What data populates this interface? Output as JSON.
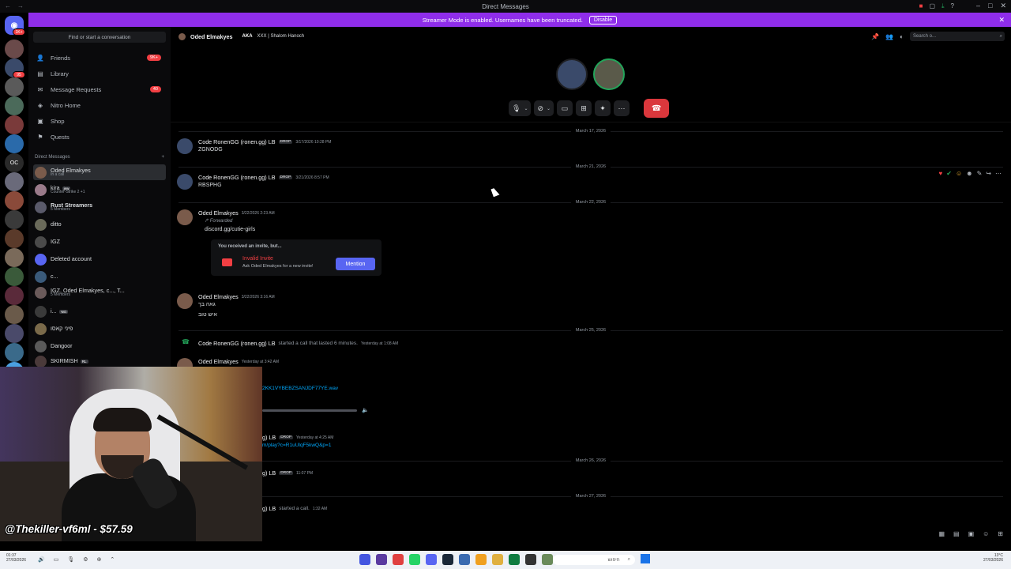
{
  "window": {
    "title": "Direct Messages"
  },
  "banner": {
    "text": "Streamer Mode is enabled. Usernames have been truncated.",
    "button": "Disable"
  },
  "sidebar": {
    "search": "Find or start a conversation",
    "nav": [
      {
        "label": "Friends",
        "icon": "friends-icon",
        "badge": "9K+"
      },
      {
        "label": "Library",
        "icon": "library-icon",
        "badge": ""
      },
      {
        "label": "Message Requests",
        "icon": "message-requests-icon",
        "badge": "40"
      },
      {
        "label": "Nitro Home",
        "icon": "nitro-icon",
        "badge": ""
      },
      {
        "label": "Shop",
        "icon": "shop-icon",
        "badge": ""
      },
      {
        "label": "Quests",
        "icon": "quests-icon",
        "badge": ""
      }
    ],
    "dm_header": "Direct Messages",
    "dm_add": "+",
    "dms": [
      {
        "name": "Oded Elmakyes",
        "sub": "In a call",
        "tag": ""
      },
      {
        "name": "kira",
        "sub": "Counter-Strike 2 +1",
        "tag": "jew"
      },
      {
        "name": "Rust Streamers",
        "sub": "5 Members",
        "tag": ""
      },
      {
        "name": "ditto",
        "sub": "",
        "tag": ""
      },
      {
        "name": "IGZ",
        "sub": "",
        "tag": ""
      },
      {
        "name": "Deleted account",
        "sub": "",
        "tag": ""
      },
      {
        "name": "c...",
        "sub": "",
        "tag": ""
      },
      {
        "name": "IGZ, Oded Elmakyes, c..., T...",
        "sub": "5 Members",
        "tag": ""
      },
      {
        "name": "i...",
        "sub": "",
        "tag": "משי"
      },
      {
        "name": "פיני קאסו",
        "sub": "",
        "tag": ""
      },
      {
        "name": "Dangoor",
        "sub": "",
        "tag": ""
      },
      {
        "name": "SKIRMISH",
        "sub": "",
        "tag": "RL"
      }
    ],
    "rail_badges": [
      "1K+",
      "95"
    ]
  },
  "header": {
    "name": "Oded Elmakyes",
    "aka_label": "AKA",
    "aka_value": "XXX | Shalom Hanoch",
    "search_placeholder": "Search o..."
  },
  "chat": {
    "dividers": [
      "March 17, 2026",
      "March 21, 2026",
      "March 22, 2026",
      "March 25, 2026",
      "March 26, 2026",
      "March 27, 2026"
    ],
    "messages": [
      {
        "user": "Code RonenGG (ronen.gg) LB",
        "tag": "DROP",
        "time": "3/17/2026 10:28 PM",
        "text": "ZGNODG"
      },
      {
        "user": "Code RonenGG (ronen.gg) LB",
        "tag": "DROP",
        "time": "3/21/2026 8:57 PM",
        "text": "RBSPHG"
      },
      {
        "user": "Oded Elmakyes",
        "tag": "",
        "time": "3/22/2026 2:23 AM",
        "forwarded": "Forwarded",
        "text": "discord.gg/cutie-girls"
      },
      {
        "user": "Oded Elmakyes",
        "tag": "",
        "time": "3/22/2026 3:16 AM",
        "text": "גאה בך",
        "text2": "איש טוב"
      },
      {
        "user": "Code RonenGG (ronen.gg) LB",
        "tag": "",
        "time": "Yesterday at 1:08 AM",
        "text": "started a call that lasted 6 minutes."
      },
      {
        "user": "Oded Elmakyes",
        "tag": "",
        "time": "Yesterday at 3:42 AM",
        "text": "2KK1VYBEBZSANJDF77YE.wav"
      },
      {
        "user": "g) LB",
        "tag": "DROP",
        "time": "Yesterday at 4:25 AM",
        "text": "m/play?c=R1uUlqF5kwQ&p=1"
      },
      {
        "user": "g) LB",
        "tag": "DROP",
        "time": "11:07 PM",
        "text": ""
      },
      {
        "user": "g) LB",
        "tag": "",
        "time": "1:32 AM",
        "text": "started a call."
      }
    ],
    "invite": {
      "header": "You received an invite, but...",
      "title": "Invalid Invite",
      "subtitle": "Ask Oded Elmakyes for a new invite!",
      "button": "Mention"
    }
  },
  "overlay": {
    "text": "@Thekiller-vf6ml - $57.59"
  },
  "taskbar": {
    "time": "01:37",
    "date": "27/03/2026",
    "search": "חיפוש",
    "weather": "13°C",
    "right_date": "27/03/2026"
  }
}
